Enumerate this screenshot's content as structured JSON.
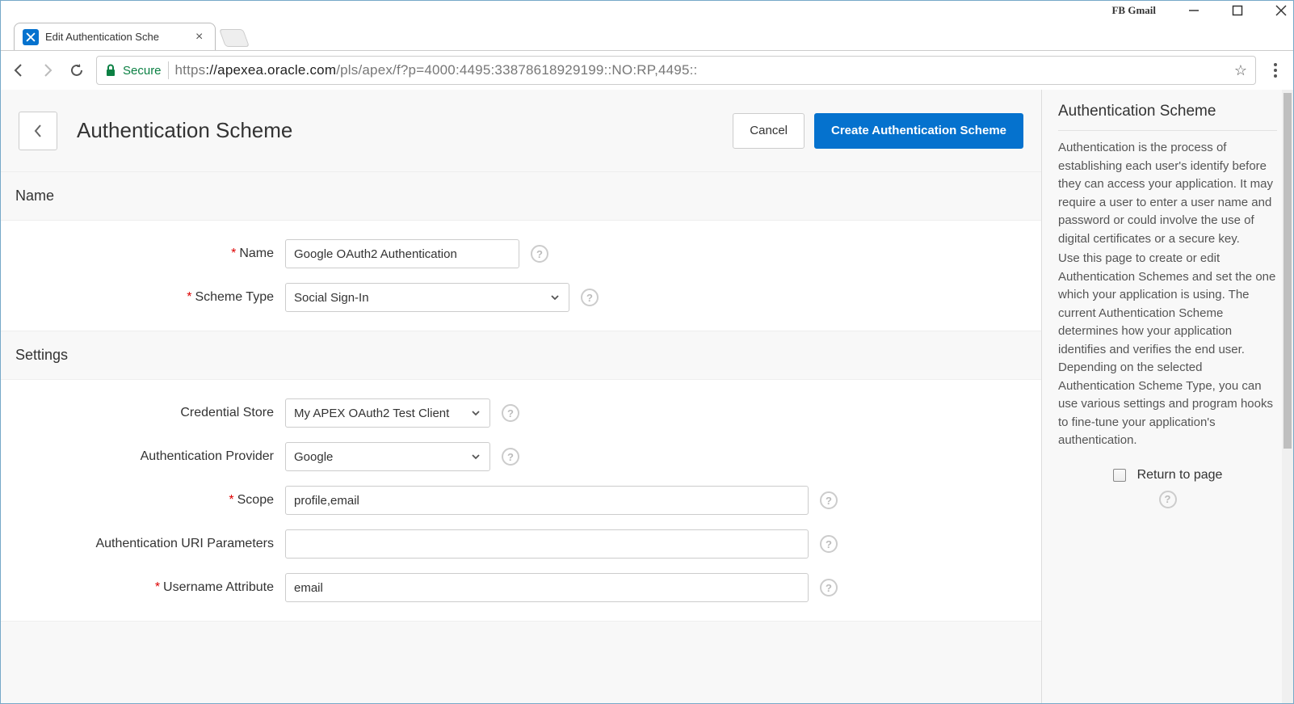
{
  "window": {
    "extension_button": "FB Gmail"
  },
  "browser": {
    "tab_title": "Edit Authentication Sche",
    "secure_label": "Secure",
    "url_scheme": "https",
    "url_host": "://apexea.oracle.com",
    "url_path": "/pls/apex/f?p=4000:4495:33878618929199::NO:RP,4495::"
  },
  "header": {
    "title": "Authentication Scheme",
    "cancel": "Cancel",
    "create": "Create Authentication Scheme"
  },
  "sections": {
    "name": {
      "title": "Name",
      "fields": {
        "name_label": "Name",
        "name_value": "Google OAuth2 Authentication",
        "scheme_type_label": "Scheme Type",
        "scheme_type_value": "Social Sign-In"
      }
    },
    "settings": {
      "title": "Settings",
      "fields": {
        "credential_store_label": "Credential Store",
        "credential_store_value": "My APEX OAuth2 Test Client",
        "auth_provider_label": "Authentication Provider",
        "auth_provider_value": "Google",
        "scope_label": "Scope",
        "scope_value": "profile,email",
        "auth_uri_params_label": "Authentication URI Parameters",
        "auth_uri_params_value": "",
        "username_attr_label": "Username Attribute",
        "username_attr_value": "email"
      }
    }
  },
  "side": {
    "title": "Authentication Scheme",
    "p1": "Authentication is the process of establishing each user's identify before they can access your application. It may require a user to enter a user name and password or could involve the use of digital certificates or a secure key.",
    "p2": "Use this page to create or edit Authentication Schemes and set the one which your application is using. The current Authentication Scheme determines how your application identifies and verifies the end user. Depending on the selected Authentication Scheme Type, you can use various settings and program hooks to fine-tune your application's authentication.",
    "return_label": "Return to page"
  }
}
